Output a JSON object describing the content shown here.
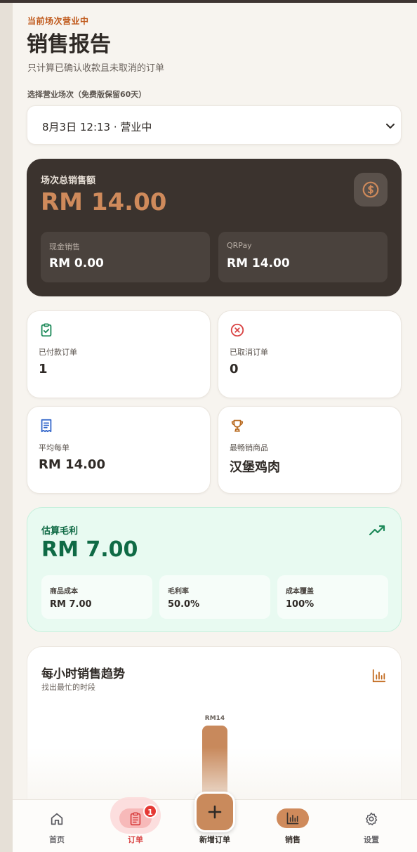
{
  "header": {
    "eyebrow": "当前场次营业中",
    "title": "销售报告",
    "subtitle": "只计算已确认收款且未取消的订单",
    "select_label": "选择营业场次（免费版保留60天）"
  },
  "session_select": {
    "value": "8月3日 12:13 · 营业中"
  },
  "summary": {
    "label": "场次总销售额",
    "total": "RM 14.00",
    "cash_label": "现金销售",
    "cash_value": "RM 0.00",
    "qr_label": "QRPay",
    "qr_value": "RM 14.00"
  },
  "stats": {
    "paid_label": "已付款订单",
    "paid_value": "1",
    "cancelled_label": "已取消订单",
    "cancelled_value": "0",
    "avg_label": "平均每单",
    "avg_value": "RM 14.00",
    "best_label": "最畅销商品",
    "best_value": "汉堡鸡肉"
  },
  "profit": {
    "label": "估算毛利",
    "value": "RM 7.00",
    "cost_label": "商品成本",
    "cost_value": "RM 7.00",
    "margin_label": "毛利率",
    "margin_value": "50.0%",
    "coverage_label": "成本覆盖",
    "coverage_value": "100%"
  },
  "hourly": {
    "title": "每小时销售趋势",
    "subtitle": "找出最忙的时段"
  },
  "chart_data": {
    "type": "bar",
    "values": [
      14
    ],
    "data_labels": [
      "RM14"
    ],
    "bar_color": "#c8895c"
  },
  "nav": {
    "home": "首页",
    "orders": "订单",
    "orders_badge": "1",
    "add": "新增订单",
    "sales": "销售",
    "settings": "设置"
  },
  "colors": {
    "accent": "#cf8a5b",
    "dark_card": "#3b332e",
    "profit_green": "#0f6a45",
    "badge_red": "#e53935"
  },
  "icons": {
    "dollar": "dollar-coin-icon",
    "paid": "clipboard-check-icon",
    "cancelled": "x-circle-icon",
    "avg": "receipt-icon",
    "best": "trophy-icon",
    "trend": "trending-up-icon",
    "chart": "bar-chart-icon",
    "home": "home-icon",
    "orders": "clipboard-list-icon",
    "add": "plus-icon",
    "sales": "bar-chart-icon",
    "settings": "gear-icon"
  }
}
